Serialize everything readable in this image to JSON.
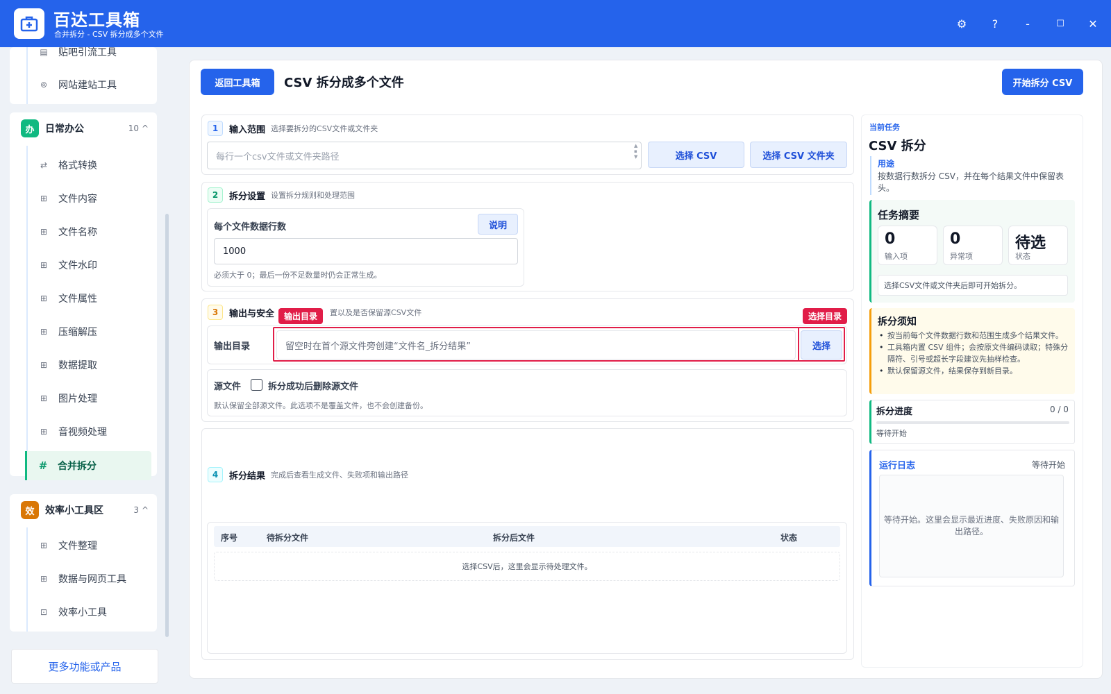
{
  "app": {
    "title": "百达工具箱",
    "subtitle": "合并拆分 - CSV 拆分成多个文件"
  },
  "titlebar_icons": [
    "gear-icon",
    "help-icon",
    "minimize-icon",
    "maximize-icon",
    "close-icon"
  ],
  "window_glyphs": {
    "help": "?",
    "minimize": "-",
    "maximize": "☐",
    "close": "✕",
    "gear": "⚙"
  },
  "sidebar": {
    "top_items": [
      {
        "label": "贴吧引流工具",
        "icon": "▤"
      },
      {
        "label": "网站建站工具",
        "icon": "⊚"
      }
    ],
    "categories": [
      {
        "name": "日常办公",
        "icon_text": "办",
        "count": "10",
        "caret": "^",
        "color": "#10b981",
        "items": [
          {
            "label": "格式转换",
            "icon": "⇄"
          },
          {
            "label": "文件内容",
            "icon": "⊞"
          },
          {
            "label": "文件名称",
            "icon": "⊞"
          },
          {
            "label": "文件水印",
            "icon": "⊞"
          },
          {
            "label": "文件属性",
            "icon": "⊞"
          },
          {
            "label": "压缩解压",
            "icon": "⊞"
          },
          {
            "label": "数据提取",
            "icon": "⊞"
          },
          {
            "label": "图片处理",
            "icon": "⊞"
          },
          {
            "label": "音视频处理",
            "icon": "⊞"
          },
          {
            "label": "合并拆分",
            "icon": "#"
          }
        ]
      },
      {
        "name": "效率小工具区",
        "icon_text": "效",
        "count": "3",
        "caret": "^",
        "color": "#d97706",
        "items": [
          {
            "label": "文件整理",
            "icon": "⊞"
          },
          {
            "label": "数据与网页工具",
            "icon": "⊞"
          },
          {
            "label": "效率小工具",
            "icon": "⊡"
          }
        ]
      }
    ],
    "more_button": "更多功能或产品"
  },
  "main": {
    "back_button": "返回工具箱",
    "page_title": "CSV 拆分成多个文件",
    "start_button": "开始拆分 CSV",
    "section1": {
      "num": "1",
      "title": "输入范围",
      "desc": "选择要拆分的CSV文件或文件夹",
      "placeholder": "每行一个csv文件或文件夹路径",
      "btn_csv": "选择 CSV",
      "btn_folder": "选择 CSV 文件夹"
    },
    "section2": {
      "num": "2",
      "title": "拆分设置",
      "desc": "设置拆分规则和处理范围",
      "rows_label": "每个文件数据行数",
      "help_button": "说明",
      "rows_value": "1000",
      "rows_hint": "必须大于 0；最后一份不足数量时仍会正常生成。"
    },
    "section3": {
      "num": "3",
      "title": "输出与安全",
      "desc": "置以及是否保留源CSV文件",
      "output_label": "输出目录",
      "output_placeholder": "留空时在首个源文件旁创建“文件名_拆分结果”",
      "choose_button": "选择",
      "tag_output": "输出目录",
      "tag_choose": "选择目录",
      "source_label": "源文件",
      "delete_checkbox_label": "拆分成功后删除源文件",
      "delete_checked": false,
      "source_hint": "默认保留全部源文件。此选项不是覆盖文件，也不会创建备份。"
    },
    "section4": {
      "num": "4",
      "title": "拆分结果",
      "desc": "完成后查看生成文件、失败项和输出路径",
      "columns": [
        "序号",
        "待拆分文件",
        "拆分后文件",
        "状态"
      ],
      "empty_text": "选择CSV后，这里会显示待处理文件。"
    }
  },
  "right_panel": {
    "current_label": "当前任务",
    "task_name": "CSV 拆分",
    "usage_label": "用途",
    "usage_text": "按数据行数拆分 CSV，并在每个结果文件中保留表头。",
    "summary_title": "任务摘要",
    "stats": [
      {
        "value": "0",
        "label": "输入项"
      },
      {
        "value": "0",
        "label": "异常项"
      },
      {
        "value": "待选",
        "label": "状态"
      }
    ],
    "summary_hint": "选择CSV文件或文件夹后即可开始拆分。",
    "notes_title": "拆分须知",
    "notes": [
      "按当前每个文件数据行数和范围生成多个结果文件。",
      "工具箱内置 CSV 组件；会按原文件编码读取；特殊分隔符、引号或超长字段建议先抽样检查。",
      "默认保留源文件，结果保存到新目录。"
    ],
    "progress_title": "拆分进度",
    "progress_count": "0 / 0",
    "progress_fraction": 0,
    "progress_status": "等待开始",
    "log_title": "运行日志",
    "log_status": "等待开始",
    "log_placeholder": "等待开始。这里会显示最近进度、失败原因和输出路径。"
  },
  "colors": {
    "brand": "#2563eb",
    "accent_green": "#10b981",
    "highlight_red": "#e11d48",
    "warning_orange": "#d97706"
  }
}
